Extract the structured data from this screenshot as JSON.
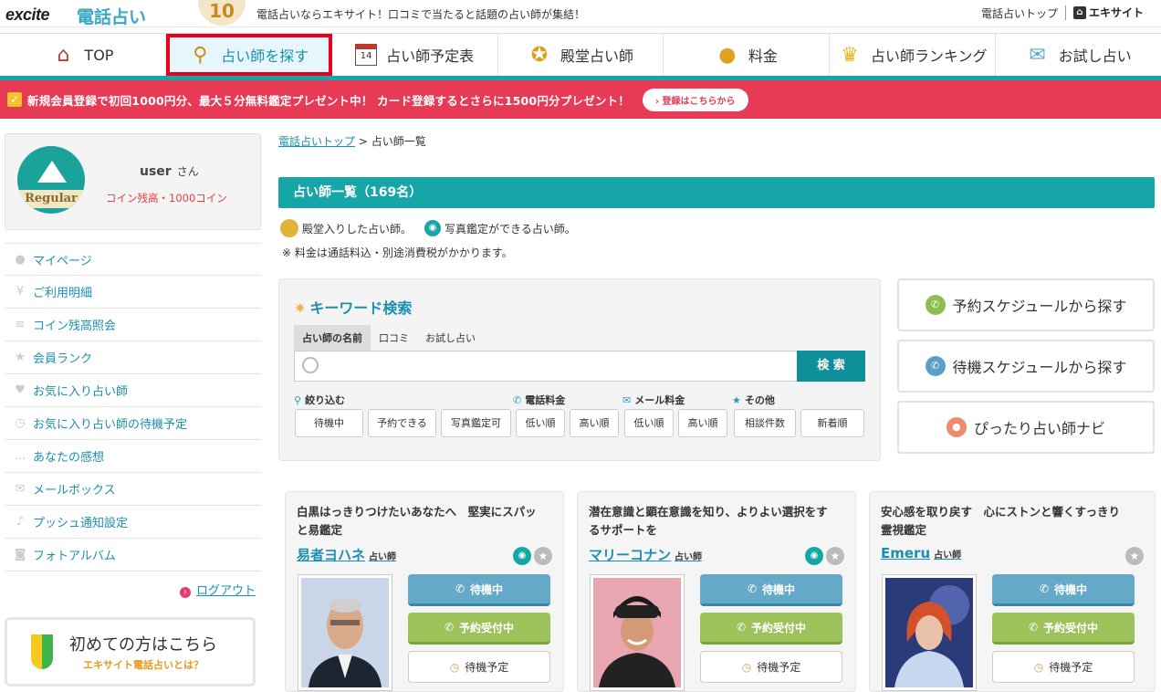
{
  "header": {
    "brand": "excite",
    "service": "電話占い",
    "anniversary": "10",
    "tagline": "電話占いならエキサイト！口コミで当たると話題の占い師が集結！",
    "top_link": "電話占いトップ",
    "excite_link": "エキサイト"
  },
  "nav": {
    "items": [
      {
        "label": "TOP",
        "icon": "house-icon"
      },
      {
        "label": "占い師を探す",
        "icon": "magnifier-icon"
      },
      {
        "label": "占い師予定表",
        "icon": "calendar-icon"
      },
      {
        "label": "殿堂占い師",
        "icon": "medal-icon"
      },
      {
        "label": "料金",
        "icon": "coins-icon"
      },
      {
        "label": "占い師ランキング",
        "icon": "crown-icon"
      },
      {
        "label": "お試し占い",
        "icon": "envelope-icon"
      }
    ],
    "active_index": 1,
    "calendar_day": "14"
  },
  "banner": {
    "text": "新規会員登録で初回1000円分、最大５分無料鑑定プレゼント中！ カード登録するとさらに1500円分プレゼント！",
    "button": "登録はこちらから"
  },
  "sidebar": {
    "rank_label": "Regular",
    "user_name": "user",
    "honorific": "さん",
    "coins": "コイン残高・1000コイン",
    "menu": [
      {
        "label": "マイページ",
        "icon": "person-icon"
      },
      {
        "label": "ご利用明細",
        "icon": "yen-icon"
      },
      {
        "label": "コイン残高照会",
        "icon": "coin-stack-icon"
      },
      {
        "label": "会員ランク",
        "icon": "star-icon"
      },
      {
        "label": "お気に入り占い師",
        "icon": "heart-icon"
      },
      {
        "label": "お気に入り占い師の待機予定",
        "icon": "clock-icon"
      },
      {
        "label": "あなたの感想",
        "icon": "speech-icon"
      },
      {
        "label": "メールボックス",
        "icon": "mail-icon"
      },
      {
        "label": "プッシュ通知設定",
        "icon": "bell-icon"
      },
      {
        "label": "フォトアルバム",
        "icon": "camera-icon"
      }
    ],
    "logout": "ログアウト",
    "first_title": "初めての方はこちら",
    "first_sub": "エキサイト電話占いとは？"
  },
  "main": {
    "breadcrumb_home": "電話占いトップ",
    "breadcrumb_sep": ">",
    "breadcrumb_current": "占い師一覧",
    "title": "占い師一覧（169名）",
    "legend_hall": "殿堂入りした占い師。",
    "legend_photo": "写真鑑定ができる占い師。",
    "note": "※ 料金は通話料込・別途消費税がかかります。"
  },
  "search": {
    "title": "キーワード検索",
    "tabs": [
      "占い師の名前",
      "口コミ",
      "お試し占い"
    ],
    "active_tab": 0,
    "value": "",
    "button": "検 索",
    "filters": {
      "narrow": {
        "label": "絞り込む",
        "options": [
          "待機中",
          "予約できる",
          "写真鑑定可"
        ]
      },
      "phone": {
        "label": "電話料金",
        "options": [
          "低い順",
          "高い順"
        ]
      },
      "mail": {
        "label": "メール料金",
        "options": [
          "低い順",
          "高い順"
        ]
      },
      "other": {
        "label": "その他",
        "options": [
          "相談件数",
          "新着順"
        ]
      }
    }
  },
  "right_buttons": [
    {
      "label": "予約スケジュールから探す",
      "color": "#8cbf4f"
    },
    {
      "label": "待機スケジュールから探す",
      "color": "#5b9fc7"
    },
    {
      "label": "ぴったり占い師ナビ",
      "color": "#f08a6c"
    }
  ],
  "cards": [
    {
      "catch": "白黒はっきりつけたいあなたへ　堅実にスパッと易鑑定",
      "name": "易者ヨハネ",
      "role": "占い師",
      "photo": true,
      "wait": "待機中",
      "reserve": "予約受付中",
      "plan": "待機予定"
    },
    {
      "catch": "潜在意識と顕在意識を知り、よりよい選択をするサポートを",
      "name": "マリーコナン",
      "role": "占い師",
      "photo": true,
      "wait": "待機中",
      "reserve": "予約受付中",
      "plan": "待機予定"
    },
    {
      "catch": "安心感を取り戻す　心にストンと響くすっきり霊視鑑定",
      "name": "Emeru",
      "role": "占い師",
      "photo": false,
      "wait": "待機中",
      "reserve": "予約受付中",
      "plan": "待機予定"
    }
  ],
  "colors": {
    "teal": "#17a6a8",
    "banner": "#e63a55",
    "link": "#1c8fb0",
    "highlight": "#e8001e"
  }
}
